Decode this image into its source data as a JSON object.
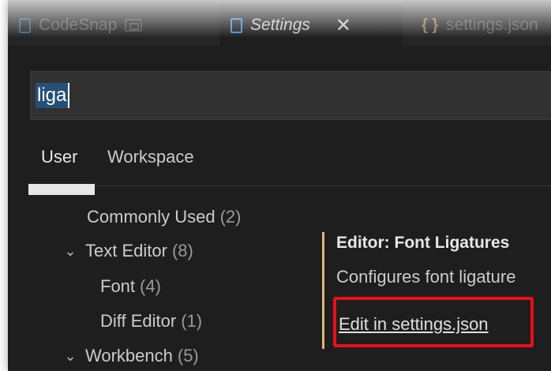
{
  "tabs": [
    {
      "label": "CodeSnap",
      "icon": "preview-icon"
    },
    {
      "label": "Settings",
      "icon": "file-icon",
      "close": "✕"
    },
    {
      "label": "settings.json",
      "icon": "json-braces-icon"
    }
  ],
  "search": {
    "value": "liga"
  },
  "scope_tabs": {
    "user": "User",
    "workspace": "Workspace"
  },
  "toc": [
    {
      "label": "Commonly Used",
      "count": "(2)"
    },
    {
      "label": "Text Editor",
      "count": "(8)"
    },
    {
      "label": "Font",
      "count": "(4)"
    },
    {
      "label": "Diff Editor",
      "count": "(1)"
    },
    {
      "label": "Workbench",
      "count": "(5)"
    }
  ],
  "setting": {
    "title": "Editor: Font Ligatures",
    "description": "Configures font ligature",
    "edit_link": "Edit in settings.json"
  },
  "colors": {
    "background": "#1e1e1e",
    "accent_bar": "#d7ba7d",
    "highlight_box": "#e8101a",
    "selection": "#264f78"
  }
}
